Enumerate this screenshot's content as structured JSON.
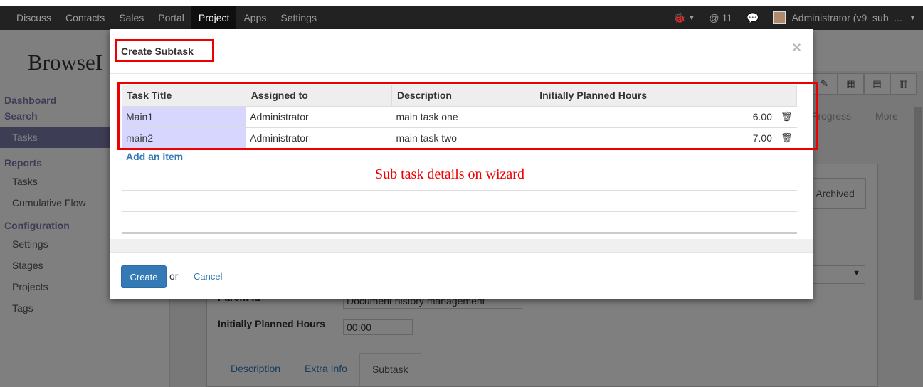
{
  "navbar": {
    "items": [
      "Discuss",
      "Contacts",
      "Sales",
      "Portal",
      "Project",
      "Apps",
      "Settings"
    ],
    "active_index": 4,
    "messages_count": "@ 11",
    "user": "Administrator (v9_sub_..."
  },
  "logo": "BrowseI",
  "sidebar": {
    "head1": "Dashboard",
    "head1b": "Search",
    "tasks_active": "Tasks",
    "head2": "Reports",
    "reports_tasks": "Tasks",
    "cumulative_flow": "Cumulative Flow",
    "head3": "Configuration",
    "settings": "Settings",
    "stages": "Stages",
    "projects": "Projects",
    "tags": "Tags"
  },
  "background": {
    "stage_progress": "Progress",
    "stage_more": "More",
    "archived": "Archived",
    "parent_label": "Parent Id",
    "parent_value": "Document history management",
    "planned_label": "Initially Planned Hours",
    "planned_value": "00:00",
    "tabs": [
      "Description",
      "Extra Info",
      "Subtask"
    ]
  },
  "modal": {
    "title": "Create Subtask",
    "close": "×",
    "columns": [
      "Task Title",
      "Assigned to",
      "Description",
      "Initially Planned Hours"
    ],
    "rows": [
      {
        "title": "Main1",
        "assigned": "Administrator",
        "description": "main task one",
        "hours": "6.00"
      },
      {
        "title": "main2",
        "assigned": "Administrator",
        "description": "main task two",
        "hours": "7.00"
      }
    ],
    "add_item": "Add an item",
    "annotation": "Sub task details on wizard",
    "create_label": "Create",
    "or_label": "or",
    "cancel_label": "Cancel"
  },
  "colors": {
    "accent": "#337ab7",
    "sidebar_active": "#7c7bad",
    "annotation_red": "#ee0000",
    "navbar_bg": "#222222"
  }
}
